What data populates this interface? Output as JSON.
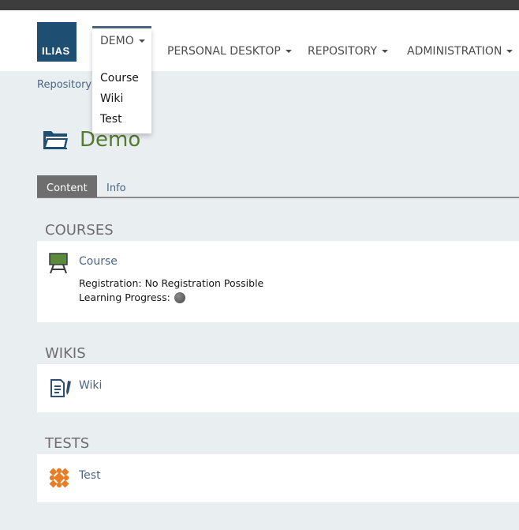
{
  "header": {
    "logo_text": "ILIAS",
    "nav": [
      {
        "label": "DEMO",
        "active": true
      },
      {
        "label": "PERSONAL DESKTOP"
      },
      {
        "label": "REPOSITORY"
      },
      {
        "label": "ADMINISTRATION"
      }
    ],
    "dropdown_items": [
      "Course",
      "Wiki",
      "Test"
    ]
  },
  "breadcrumb": [
    "Repository"
  ],
  "page": {
    "title": "Demo",
    "icon": "folder-icon"
  },
  "tabs": [
    {
      "label": "Content",
      "active": true
    },
    {
      "label": "Info"
    }
  ],
  "blocks": [
    {
      "title": "COURSES",
      "items": [
        {
          "name": "Course",
          "icon": "course-blackboard-icon",
          "properties": [
            {
              "label": "Registration:",
              "value": "No Registration Possible"
            },
            {
              "label": "Learning Progress:",
              "value": ""
            }
          ]
        }
      ]
    },
    {
      "title": "WIKIS",
      "items": [
        {
          "name": "Wiki",
          "icon": "wiki-icon"
        }
      ]
    },
    {
      "title": "TESTS",
      "items": [
        {
          "name": "Test",
          "icon": "test-puzzle-icon"
        }
      ]
    }
  ],
  "colors": {
    "brand": "#1e4f73",
    "link": "#4c6586",
    "title_green": "#557b2e",
    "test_orange": "#e87d26"
  }
}
